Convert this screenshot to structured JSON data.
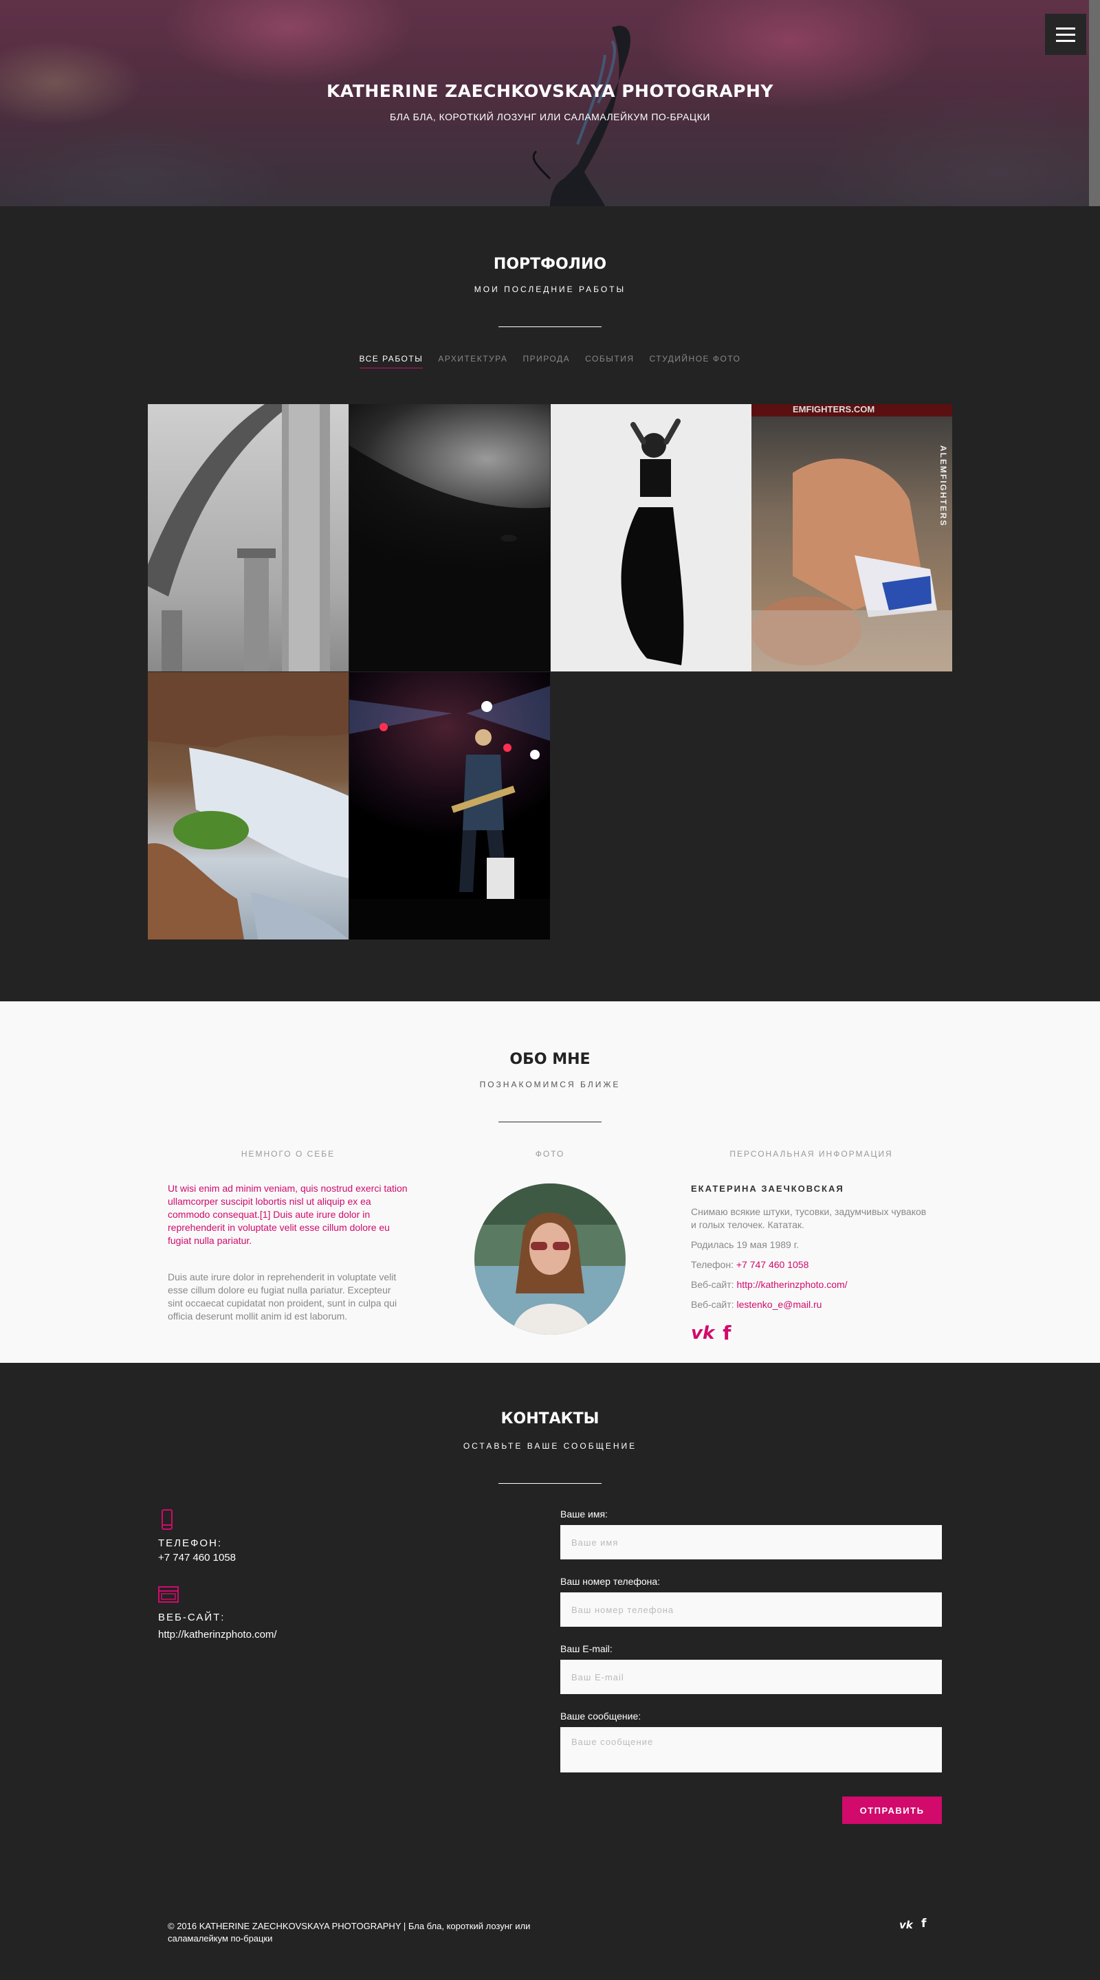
{
  "hero": {
    "title": "KATHERINE ZAECHKOVSKAYA PHOTOGRAPHY",
    "subtitle": "БЛА БЛА, КОРОТКИЙ ЛОЗУНГ ИЛИ САЛАМАЛЕЙКУМ ПО-БРАЦКИ",
    "menu_icon": "hamburger-icon"
  },
  "portfolio": {
    "title": "ПОРТФОЛИО",
    "subtitle": "МОИ ПОСЛЕДНИЕ РАБОТЫ",
    "filters": [
      "ВСЕ РАБОТЫ",
      "АРХИТЕКТУРА",
      "ПРИРОДА",
      "СОБЫТИЯ",
      "СТУДИЙНОЕ ФОТО"
    ],
    "active_filter": "ВСЕ РАБОТЫ",
    "fight_banner": "EMFIGHTERS.COM",
    "fight_cage": "ALEMFIGHTERS"
  },
  "about": {
    "title": "ОБО МНЕ",
    "subtitle": "ПОЗНАКОМИМСЯ БЛИЖЕ",
    "col_about": "НЕМНОГО О СЕБЕ",
    "col_photo": "ФОТО",
    "col_info": "ПЕРСОНАЛЬНАЯ ИНФОРМАЦИЯ",
    "text_pink": "Ut wisi enim ad minim veniam, quis nostrud exerci tation ullamcorper suscipit lobortis nisl ut aliquip ex ea commodo consequat.[1] Duis aute irure dolor in reprehenderit in voluptate velit esse cillum dolore eu fugiat nulla pariatur.",
    "text_grey": "Duis aute irure dolor in reprehenderit in voluptate velit esse cillum dolore eu fugiat nulla pariatur. Excepteur sint occaecat cupidatat non proident, sunt in culpa qui officia deserunt mollit anim id est laborum.",
    "name": "ЕКАТЕРИНА ЗАЕЧКОВСКАЯ",
    "bio": "Снимаю всякие штуки, тусовки, задумчивых чуваков и голых телочек. Кататак.",
    "born": "Родилась 19 мая 1989 г.",
    "phone_label": "Телефон:",
    "phone": "+7 747 460 1058",
    "site_label": "Веб-сайт:",
    "site": "http://katherinzphoto.com/",
    "site2_label": "Веб-сайт:",
    "email": "lestenko_e@mail.ru",
    "social_icons": [
      "vk-icon",
      "facebook-icon"
    ]
  },
  "contacts": {
    "title": "КОНТАКТЫ",
    "subtitle": "ОСТАВЬТЕ ВАШЕ СООБЩЕНИЕ",
    "phone_label": "ТЕЛЕФОН:",
    "phone": "+7 747 460 1058",
    "site_label": "ВЕБ-САЙТ:",
    "site": "http://katherinzphoto.com/",
    "form": {
      "name_label": "Ваше имя:",
      "name_placeholder": "Ваше имя",
      "phone_label": "Ваш номер телефона:",
      "phone_placeholder": "Ваш номер телефона",
      "email_label": "Ваш E-mail:",
      "email_placeholder": "Ваш E-mail",
      "message_label": "Ваше сообщение:",
      "message_placeholder": "Ваше сообщение",
      "submit": "ОТПРАВИТЬ"
    },
    "accent": "#d10a6b"
  },
  "footer": {
    "text": "© 2016 KATHERINE ZAECHKOVSKAYA PHOTOGRAPHY | Бла бла, короткий лозунг или саламалейкум по-брацки",
    "vk": "vk",
    "fb": "f"
  }
}
